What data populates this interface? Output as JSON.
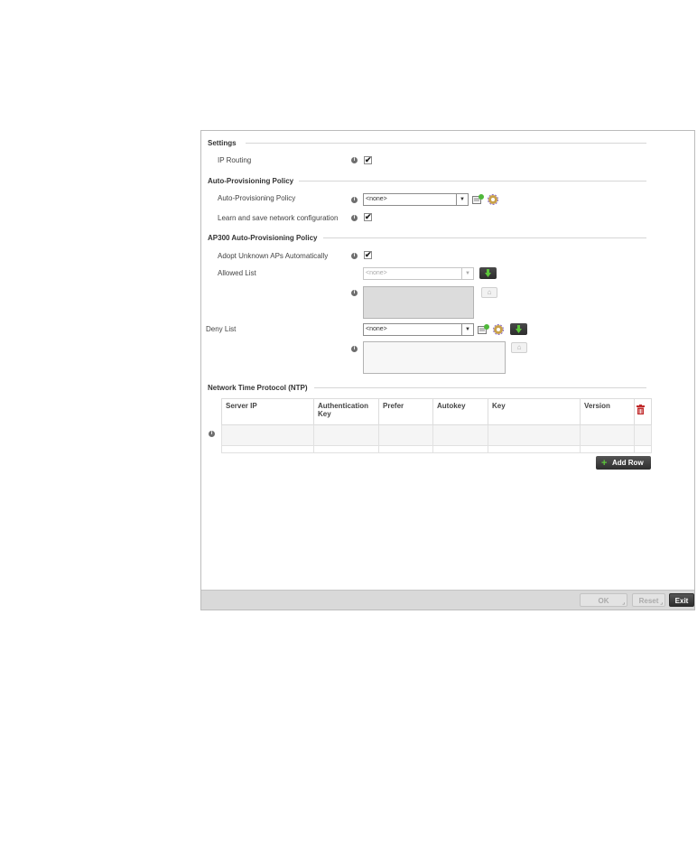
{
  "settings": {
    "title": "Settings",
    "ip_routing_label": "IP Routing",
    "ip_routing_checked": "✔"
  },
  "auto_provisioning": {
    "title": "Auto-Provisioning Policy",
    "policy_label": "Auto-Provisioning Policy",
    "policy_value": "<none>",
    "learn_label": "Learn and save network configuration",
    "learn_checked": "✔"
  },
  "ap300": {
    "title": "AP300 Auto-Provisioning Policy",
    "adopt_label": "Adopt Unknown APs Automatically",
    "adopt_checked": "✔",
    "allowed_label": "Allowed List",
    "allowed_value": "<none>",
    "deny_label": "Deny List",
    "deny_value": "<none>"
  },
  "ntp": {
    "title": "Network Time Protocol (NTP)",
    "columns": [
      "Server IP",
      "Authentication Key",
      "Prefer",
      "Autokey",
      "Key",
      "Version"
    ],
    "add_row_label": "Add Row"
  },
  "footer": {
    "ok_label": "OK",
    "reset_label": "Reset",
    "exit_label": "Exit"
  },
  "icons": {
    "info": "info-icon",
    "add_policy": "add-policy-icon",
    "configure": "gear-icon",
    "down": "arrow-down-icon",
    "remove": "remove-icon",
    "delete": "trash-icon",
    "plus": "plus-icon"
  },
  "colors": {
    "accent_green": "#5cc63a",
    "delete_red": "#c0292a"
  }
}
